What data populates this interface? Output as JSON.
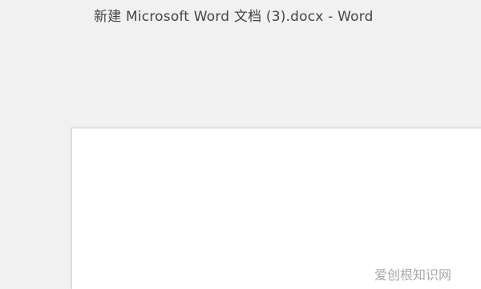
{
  "window": {
    "title": "新建 Microsoft Word 文档 (3).docx  -  Word"
  },
  "watermark": {
    "text": "爱创根知识网"
  },
  "colors": {
    "app_background": "#f1f1f1",
    "page_background": "#ffffff",
    "title_text": "#454545"
  }
}
